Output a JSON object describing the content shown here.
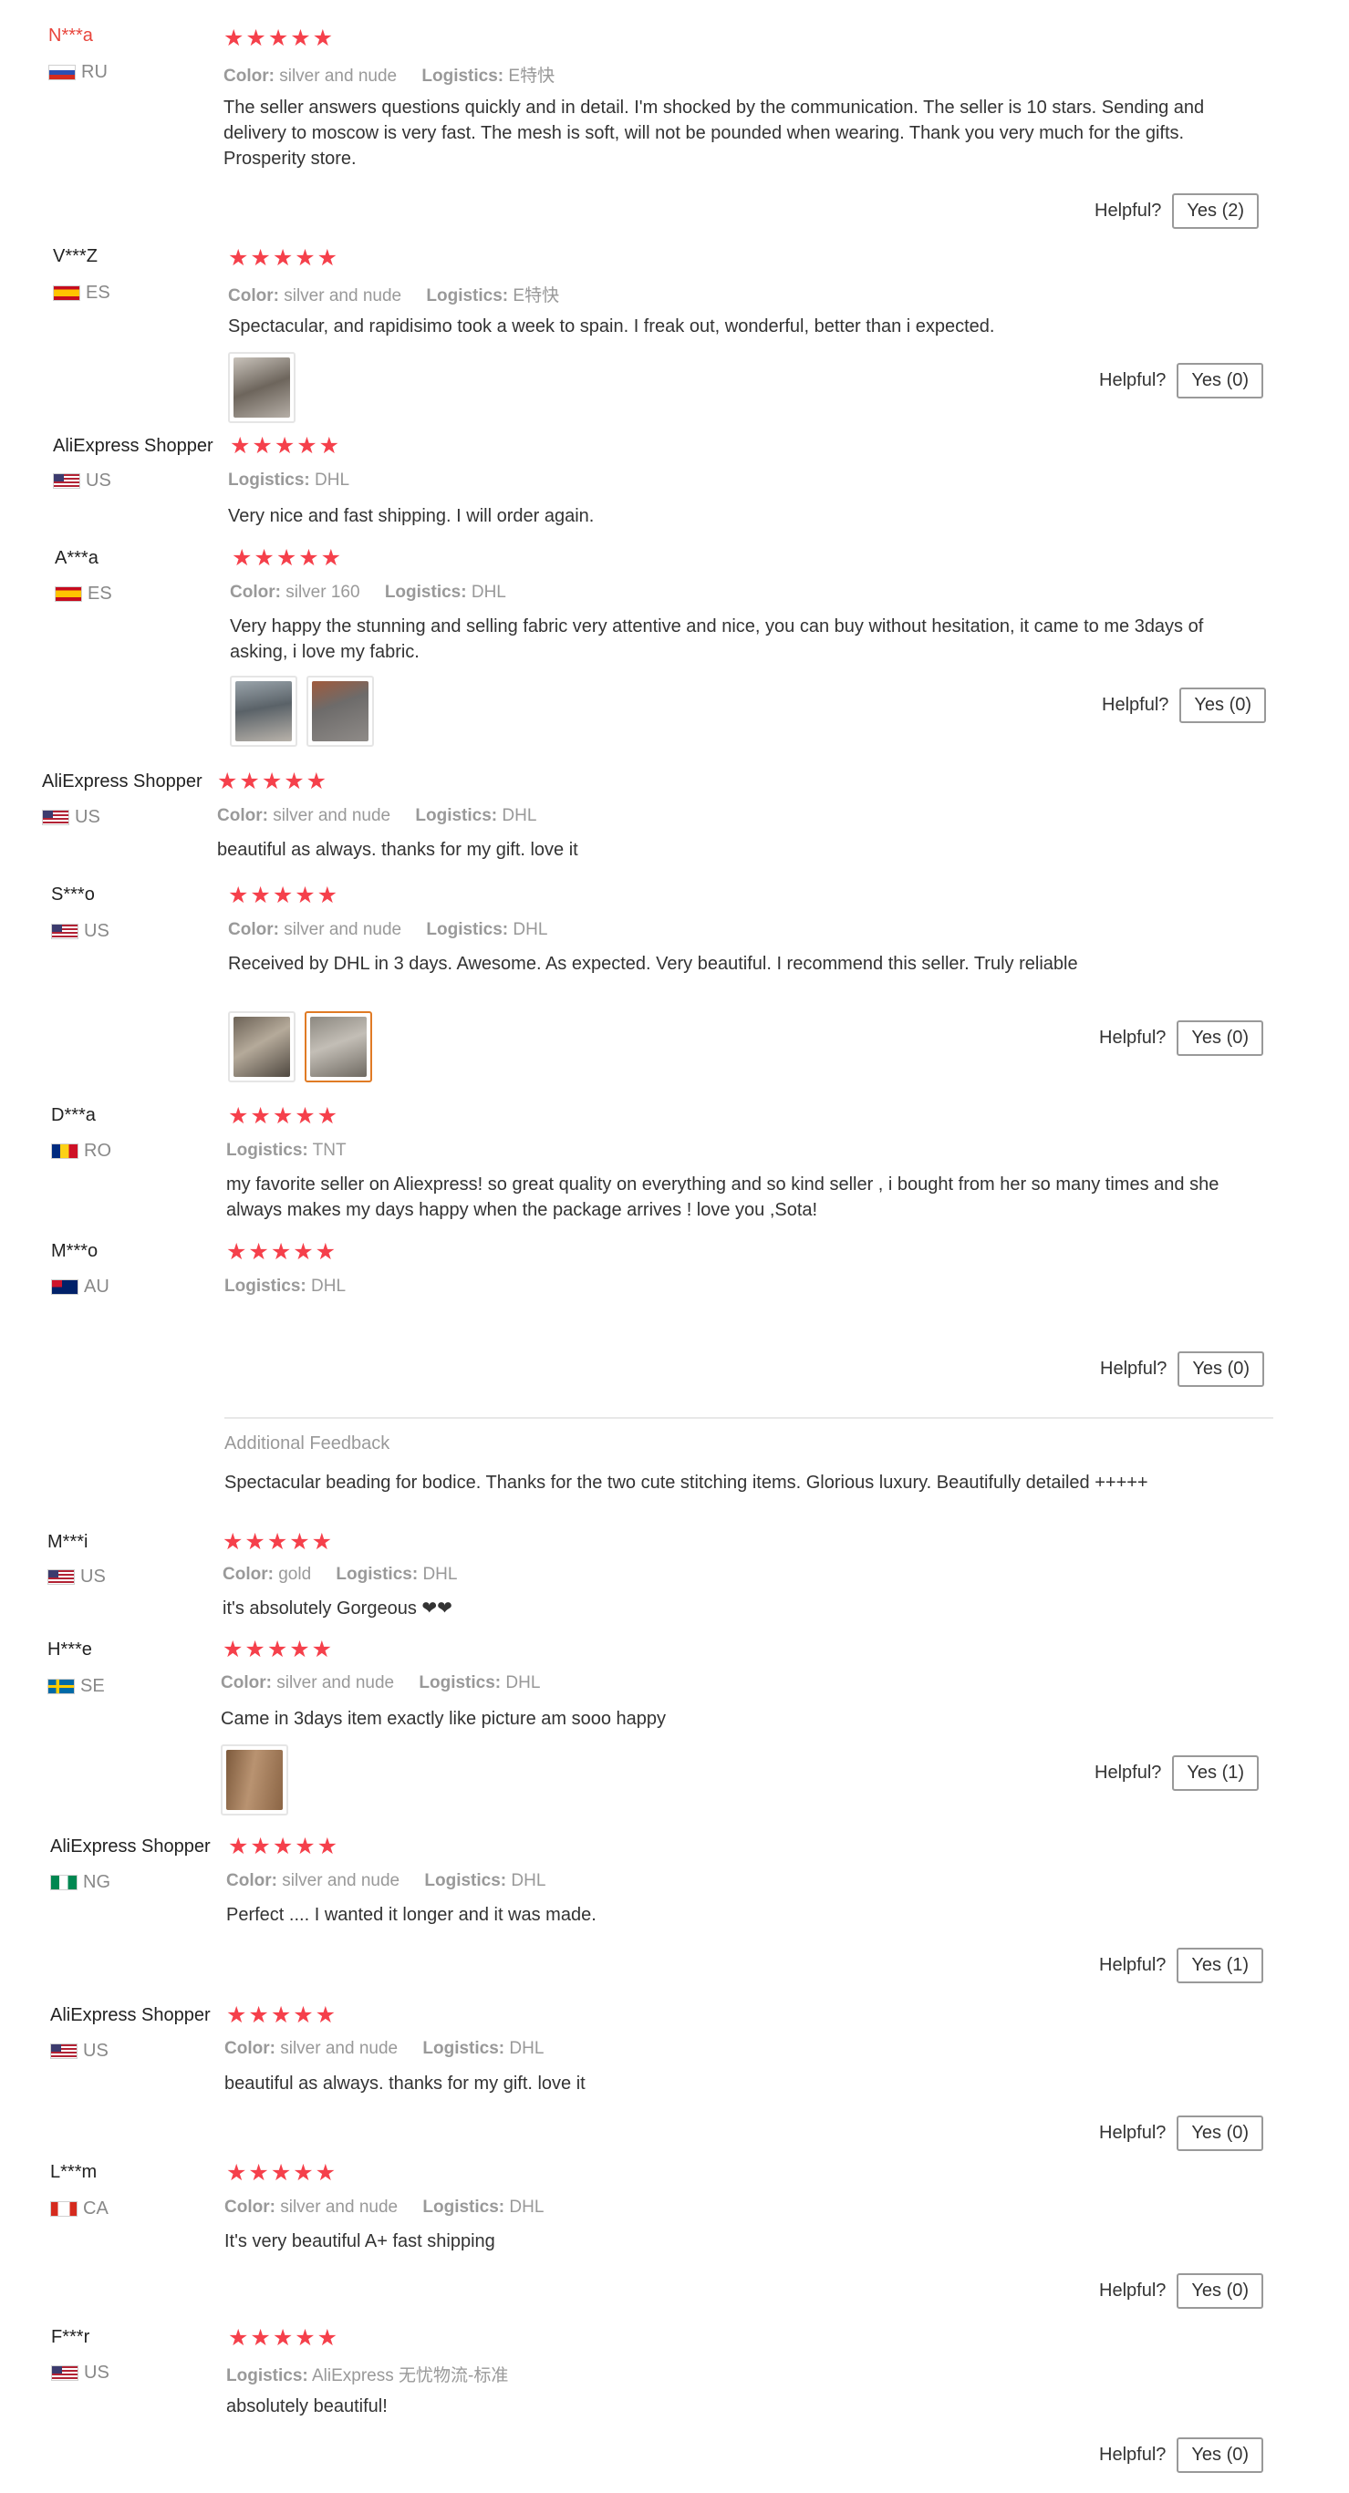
{
  "helpful_label": "Helpful?",
  "colors": {
    "star": "#f5404b",
    "highlight_name": "#e8453c",
    "active_thumb": "#e07b25"
  },
  "reviews": [
    {
      "user": "N***a",
      "country": "RU",
      "flag_icon": "russia-flag-icon",
      "stars": "★★★★★",
      "color_label": "Color:",
      "color": "silver and nude",
      "logistics_label": "Logistics:",
      "logistics": "E特快",
      "text": "The seller answers questions quickly and in detail. I'm shocked by the communication. The seller is 10 stars. Sending and delivery to moscow is very fast. The mesh is soft, will not be pounded when wearing. Thank you very much for the gifts. Prosperity store.",
      "helpful_btn": "Yes (2)"
    },
    {
      "user": "V***Z",
      "country": "ES",
      "flag_icon": "spain-flag-icon",
      "stars": "★★★★★",
      "color_label": "Color:",
      "color": "silver and nude",
      "logistics_label": "Logistics:",
      "logistics": "E特快",
      "text": "Spectacular, and rapidisimo took a week to spain. I freak out, wonderful, better than i expected.",
      "helpful_btn": "Yes (0)"
    },
    {
      "user": "AliExpress Shopper",
      "country": "US",
      "flag_icon": "usa-flag-icon",
      "stars": "★★★★★",
      "logistics_label": "Logistics:",
      "logistics": "DHL",
      "text": "Very nice and fast shipping. I will order again."
    },
    {
      "user": "A***a",
      "country": "ES",
      "flag_icon": "spain-flag-icon",
      "stars": "★★★★★",
      "color_label": "Color:",
      "color": "silver 160",
      "logistics_label": "Logistics:",
      "logistics": "DHL",
      "text": "Very happy the stunning and selling fabric very attentive and nice, you can buy without hesitation, it came to me 3days of asking, i love my fabric.",
      "helpful_btn": "Yes (0)"
    },
    {
      "user": "AliExpress Shopper",
      "country": "US",
      "flag_icon": "usa-flag-icon",
      "stars": "★★★★★",
      "color_label": "Color:",
      "color": "silver and nude",
      "logistics_label": "Logistics:",
      "logistics": "DHL",
      "text": "beautiful as always. thanks for my gift. love it"
    },
    {
      "user": "S***o",
      "country": "US",
      "flag_icon": "usa-flag-icon",
      "stars": "★★★★★",
      "color_label": "Color:",
      "color": "silver and nude",
      "logistics_label": "Logistics:",
      "logistics": "DHL",
      "text": "Received by DHL in 3 days. Awesome. As expected. Very beautiful. I recommend this seller. Truly reliable",
      "helpful_btn": "Yes (0)"
    },
    {
      "user": "D***a",
      "country": "RO",
      "flag_icon": "romania-flag-icon",
      "stars": "★★★★★",
      "logistics_label": "Logistics:",
      "logistics": "TNT",
      "text": "my favorite seller on Aliexpress! so great quality on everything and so kind seller , i bought from her so many times and she always makes my days happy when the package arrives ! love you ,Sota!"
    },
    {
      "user": "M***o",
      "country": "AU",
      "flag_icon": "australia-flag-icon",
      "stars": "★★★★★",
      "logistics_label": "Logistics:",
      "logistics": "DHL",
      "helpful_btn": "Yes (0)",
      "additional_title": "Additional Feedback",
      "additional_text": "Spectacular beading for bodice. Thanks for the two cute stitching items. Glorious luxury. Beautifully detailed +++++"
    },
    {
      "user": "M***i",
      "country": "US",
      "flag_icon": "usa-flag-icon",
      "stars": "★★★★★",
      "color_label": "Color:",
      "color": "gold",
      "logistics_label": "Logistics:",
      "logistics": "DHL",
      "text": "it's absolutely Gorgeous ❤❤"
    },
    {
      "user": "H***e",
      "country": "SE",
      "flag_icon": "sweden-flag-icon",
      "stars": "★★★★★",
      "color_label": "Color:",
      "color": "silver and nude",
      "logistics_label": "Logistics:",
      "logistics": "DHL",
      "text": "Came in 3days item exactly like picture am sooo happy",
      "helpful_btn": "Yes (1)"
    },
    {
      "user": "AliExpress Shopper",
      "country": "NG",
      "flag_icon": "nigeria-flag-icon",
      "stars": "★★★★★",
      "color_label": "Color:",
      "color": "silver and nude",
      "logistics_label": "Logistics:",
      "logistics": "DHL",
      "text": "Perfect .... I wanted it longer and it was made.",
      "helpful_btn": "Yes (1)"
    },
    {
      "user": "AliExpress Shopper",
      "country": "US",
      "flag_icon": "usa-flag-icon",
      "stars": "★★★★★",
      "color_label": "Color:",
      "color": "silver and nude",
      "logistics_label": "Logistics:",
      "logistics": "DHL",
      "text": "beautiful as always. thanks for my gift. love it",
      "helpful_btn": "Yes (0)"
    },
    {
      "user": "L***m",
      "country": "CA",
      "flag_icon": "canada-flag-icon",
      "stars": "★★★★★",
      "color_label": "Color:",
      "color": "silver and nude",
      "logistics_label": "Logistics:",
      "logistics": "DHL",
      "text": "It's very beautiful A+ fast shipping",
      "helpful_btn": "Yes (0)"
    },
    {
      "user": "F***r",
      "country": "US",
      "flag_icon": "usa-flag-icon",
      "stars": "★★★★★",
      "logistics_label": "Logistics:",
      "logistics": "AliExpress 无忧物流-标准",
      "text": "absolutely beautiful!",
      "helpful_btn": "Yes (0)"
    }
  ]
}
